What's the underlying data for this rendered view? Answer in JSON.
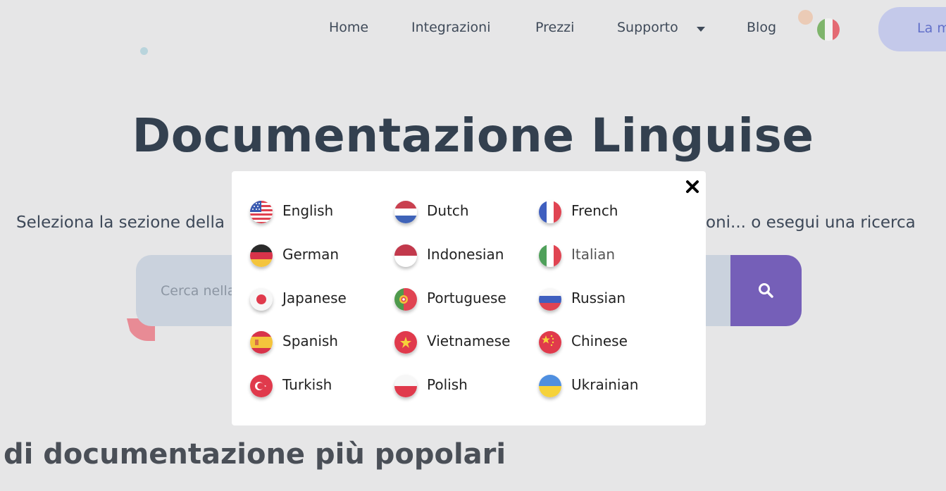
{
  "nav": {
    "items": [
      "Home",
      "Integrazioni",
      "Prezzi",
      "Supporto",
      "Blog"
    ],
    "current_flag": "italy-flag-icon",
    "cta_label": "La m"
  },
  "hero": {
    "title": "Documentazione Linguise",
    "subtitle_left": "Seleziona la sezione della",
    "subtitle_right": "oni... o esegui una ricerca"
  },
  "search": {
    "placeholder": "Cerca nella",
    "button_icon": "search-icon",
    "button_color": "#755fb8"
  },
  "section": {
    "title": "di documentazione più popolari"
  },
  "language_modal": {
    "close_icon": "close-icon",
    "languages": [
      [
        "English",
        "Dutch",
        "French"
      ],
      [
        "German",
        "Indonesian",
        "Italian"
      ],
      [
        "Japanese",
        "Portuguese",
        "Russian"
      ],
      [
        "Spanish",
        "Vietnamese",
        "Chinese"
      ],
      [
        "Turkish",
        "Polish",
        "Ukrainian"
      ]
    ],
    "selected": "Italian"
  }
}
